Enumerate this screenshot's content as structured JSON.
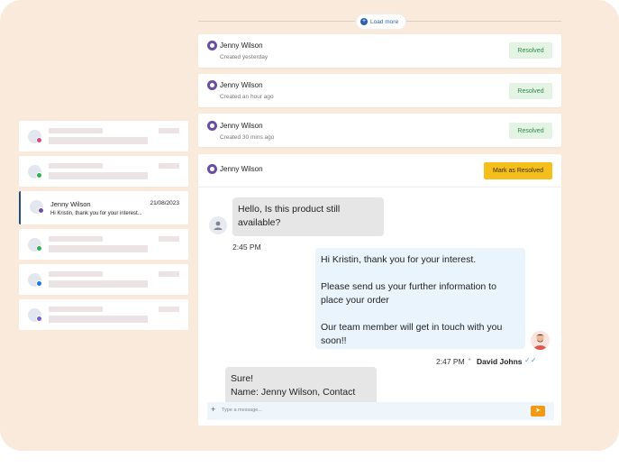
{
  "load_more": {
    "label": "Load more",
    "icon": "plus-circle-icon"
  },
  "tickets": [
    {
      "name": "Jenny Wilson",
      "created": "Created yesterday",
      "status": "Resolved"
    },
    {
      "name": "Jenny Wilson",
      "created": "Created an hour ago",
      "status": "Resolved"
    },
    {
      "name": "Jenny Wilson",
      "created": "Created 30 mins ago",
      "status": "Resolved"
    }
  ],
  "chat": {
    "contact_name": "Jenny Wilson",
    "action_label": "Mark as Resolved",
    "messages": [
      {
        "from": "customer",
        "lines": [
          "Hello, Is this product still",
          "available?"
        ],
        "time": "2:45 PM"
      },
      {
        "from": "agent",
        "paragraphs": [
          "Hi Kristin, thank you for your interest.",
          "Please send us your further information to place your order",
          "Our team member will get in touch with you soon!!"
        ],
        "time": "2:47 PM",
        "sender": "David Johns"
      },
      {
        "from": "customer",
        "lines": [
          "Sure!",
          "Name: Jenny Wilson, Contact"
        ]
      }
    ],
    "input_placeholder": "Type a message...",
    "send_icon": "send-icon"
  },
  "conversation_list": {
    "active": {
      "name": "Jenny Wilson",
      "date": "21/08/2023",
      "preview": "Hi Kristin, thank you for your interest..."
    },
    "channel_badges": [
      {
        "channel": "instagram",
        "color": "#e0467c"
      },
      {
        "channel": "whatsapp",
        "color": "#2eb24a"
      },
      {
        "channel": "viber",
        "color": "#6a4f9c"
      },
      {
        "channel": "whatsapp",
        "color": "#2eb24a"
      },
      {
        "channel": "facebook",
        "color": "#1877f2"
      },
      {
        "channel": "messenger",
        "color": "#7a5cd6"
      }
    ]
  },
  "colors": {
    "accent_yellow": "#f5bf1b",
    "resolved_green": "#2f8a43",
    "send_orange": "#f39a15",
    "background_peach": "#f9eadb"
  }
}
